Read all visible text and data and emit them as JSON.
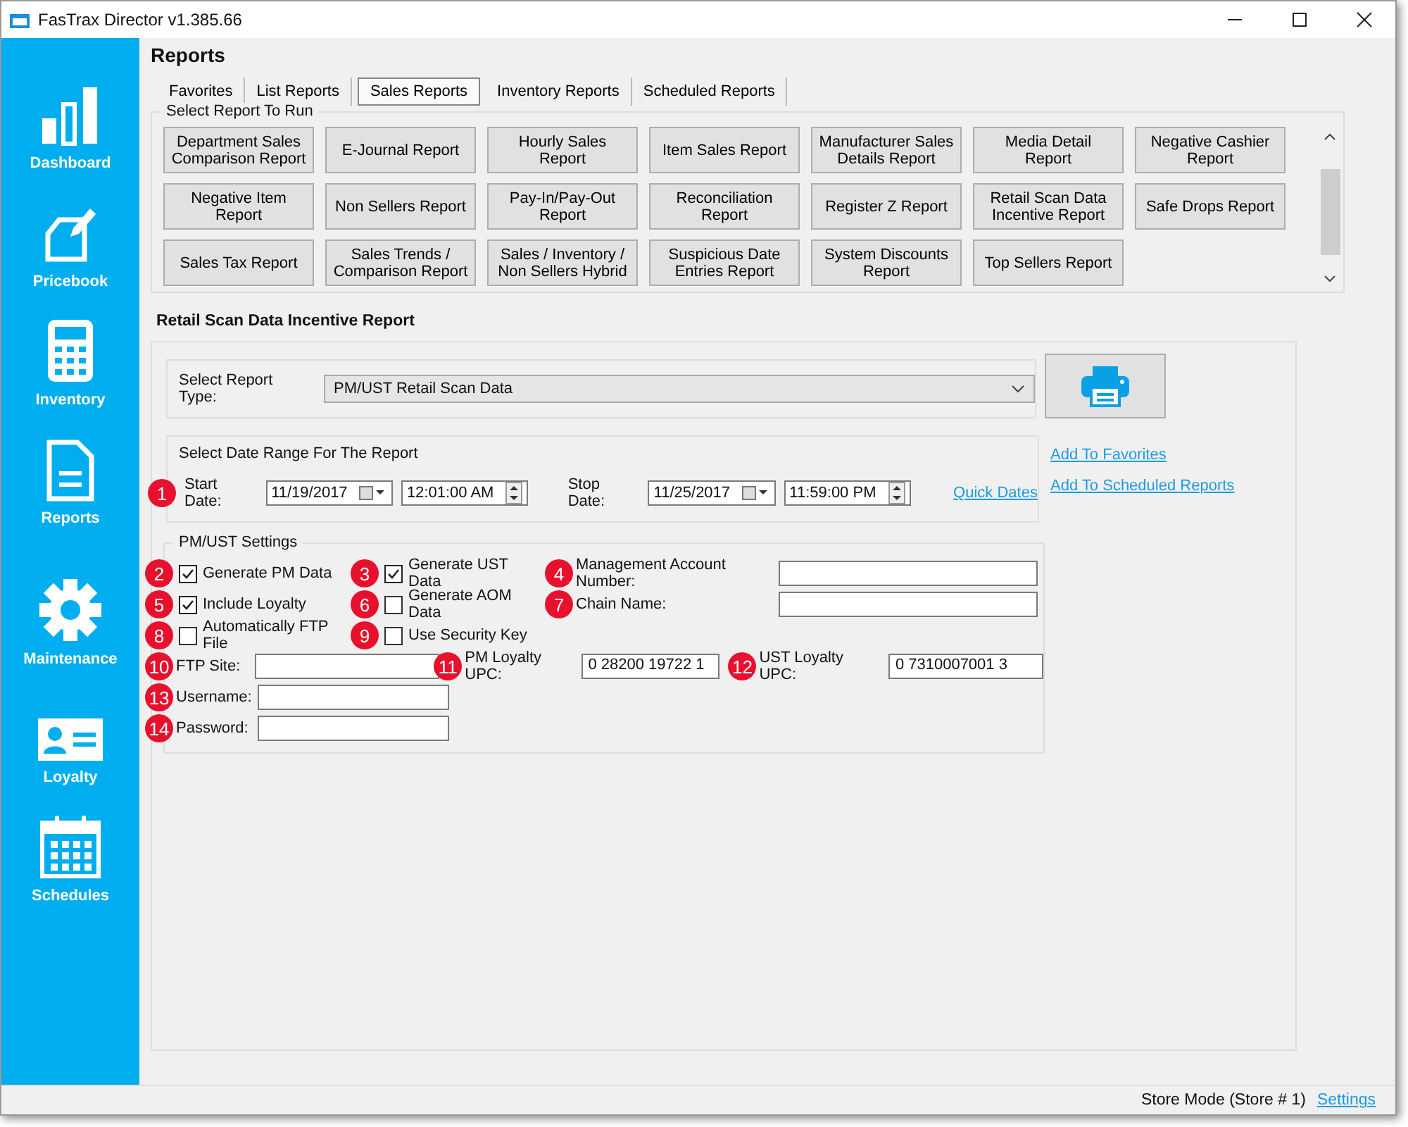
{
  "window": {
    "title": "FasTrax Director v1.385.66"
  },
  "sidebar": {
    "items": [
      {
        "label": "Dashboard",
        "kind": "dashboard"
      },
      {
        "label": "Pricebook",
        "kind": "pricebook"
      },
      {
        "label": "Inventory",
        "kind": "inventory"
      },
      {
        "label": "Reports",
        "kind": "reports"
      },
      {
        "label": "Maintenance",
        "kind": "maintenance"
      },
      {
        "label": "Loyalty",
        "kind": "loyalty"
      },
      {
        "label": "Schedules",
        "kind": "schedules"
      }
    ]
  },
  "page_title": "Reports",
  "tabs": [
    {
      "label": "Favorites",
      "selected": false
    },
    {
      "label": "List Reports",
      "selected": false
    },
    {
      "label": "Sales Reports",
      "selected": true
    },
    {
      "label": "Inventory Reports",
      "selected": false
    },
    {
      "label": "Scheduled Reports",
      "selected": false
    }
  ],
  "report_picker": {
    "legend": "Select Report To Run",
    "buttons": [
      "Department Sales Comparison Report",
      "E-Journal Report",
      "Hourly Sales Report",
      "Item Sales Report",
      "Manufacturer Sales Details Report",
      "Media Detail Report",
      "Negative Cashier Report",
      "Negative Item Report",
      "Non Sellers Report",
      "Pay-In/Pay-Out Report",
      "Reconciliation Report",
      "Register Z Report",
      "Retail Scan Data Incentive Report",
      "Safe Drops Report",
      "Sales Tax Report",
      "Sales Trends / Comparison Report",
      "Sales / Inventory / Non Sellers Hybrid",
      "Suspicious Date Entries Report",
      "System Discounts Report",
      "Top Sellers Report"
    ]
  },
  "report": {
    "title": "Retail Scan Data Incentive Report",
    "report_type": {
      "label": "Select Report Type:",
      "value": "PM/UST Retail Scan Data"
    },
    "date_range": {
      "legend": "Select Date Range For The Report",
      "callout": "1",
      "start_label": "Start Date:",
      "start_date": "11/19/2017",
      "start_time": "12:01:00 AM",
      "stop_label": "Stop Date:",
      "stop_date": "11/25/2017",
      "stop_time": "11:59:00 PM",
      "quick_dates": "Quick Dates"
    },
    "links": [
      "Add To Favorites",
      "Add To Scheduled Reports"
    ],
    "settings": {
      "legend": "PM/UST Settings",
      "checkboxes": [
        {
          "callout": "2",
          "label": "Generate PM Data",
          "checked": true
        },
        {
          "callout": "3",
          "label": "Generate UST Data",
          "checked": true
        },
        {
          "callout": "5",
          "label": "Include Loyalty",
          "checked": true
        },
        {
          "callout": "6",
          "label": "Generate AOM Data",
          "checked": false
        },
        {
          "callout": "8",
          "label": "Automatically FTP File",
          "checked": false
        },
        {
          "callout": "9",
          "label": "Use Security Key",
          "checked": false
        }
      ],
      "side_fields": [
        {
          "callout": "4",
          "label": "Management Account Number:"
        },
        {
          "callout": "7",
          "label": "Chain Name:"
        }
      ],
      "ftp_site": {
        "callout": "10",
        "label": "FTP Site:"
      },
      "pm_upc": {
        "callout": "11",
        "label": "PM Loyalty UPC:",
        "value": "0 28200 19722 1"
      },
      "ust_upc": {
        "callout": "12",
        "label": "UST Loyalty UPC:",
        "value": "0 7310007001 3"
      },
      "username": {
        "callout": "13",
        "label": "Username:"
      },
      "password": {
        "callout": "14",
        "label": "Password:"
      }
    }
  },
  "status_bar": {
    "mode": "Store Mode (Store # 1)",
    "settings_link": "Settings"
  }
}
